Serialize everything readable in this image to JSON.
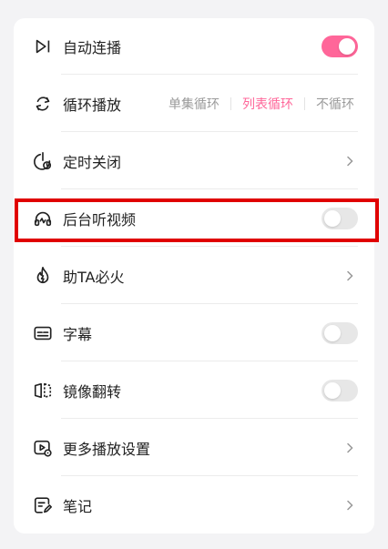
{
  "colors": {
    "accent": "#ff6699",
    "highlight_border": "#e00000",
    "toggle_off": "#e7e7e7"
  },
  "settings": {
    "auto_connect": {
      "label": "自动连播",
      "icon": "play-next-icon",
      "toggle": "on"
    },
    "loop_play": {
      "label": "循环播放",
      "icon": "loop-icon",
      "options": [
        "单集循环",
        "列表循环",
        "不循环"
      ],
      "selected": "列表循环"
    },
    "timer_close": {
      "label": "定时关闭",
      "icon": "timer-icon"
    },
    "background_audio": {
      "label": "后台听视频",
      "icon": "headphones-icon",
      "toggle": "off"
    },
    "help_ta": {
      "label": "助TA必火",
      "icon": "fire-icon"
    },
    "subtitles": {
      "label": "字幕",
      "icon": "subtitle-icon",
      "toggle": "off"
    },
    "mirror_flip": {
      "label": "镜像翻转",
      "icon": "mirror-icon",
      "toggle": "off"
    },
    "more_settings": {
      "label": "更多播放设置",
      "icon": "play-settings-icon"
    },
    "notes": {
      "label": "笔记",
      "icon": "note-icon"
    }
  }
}
